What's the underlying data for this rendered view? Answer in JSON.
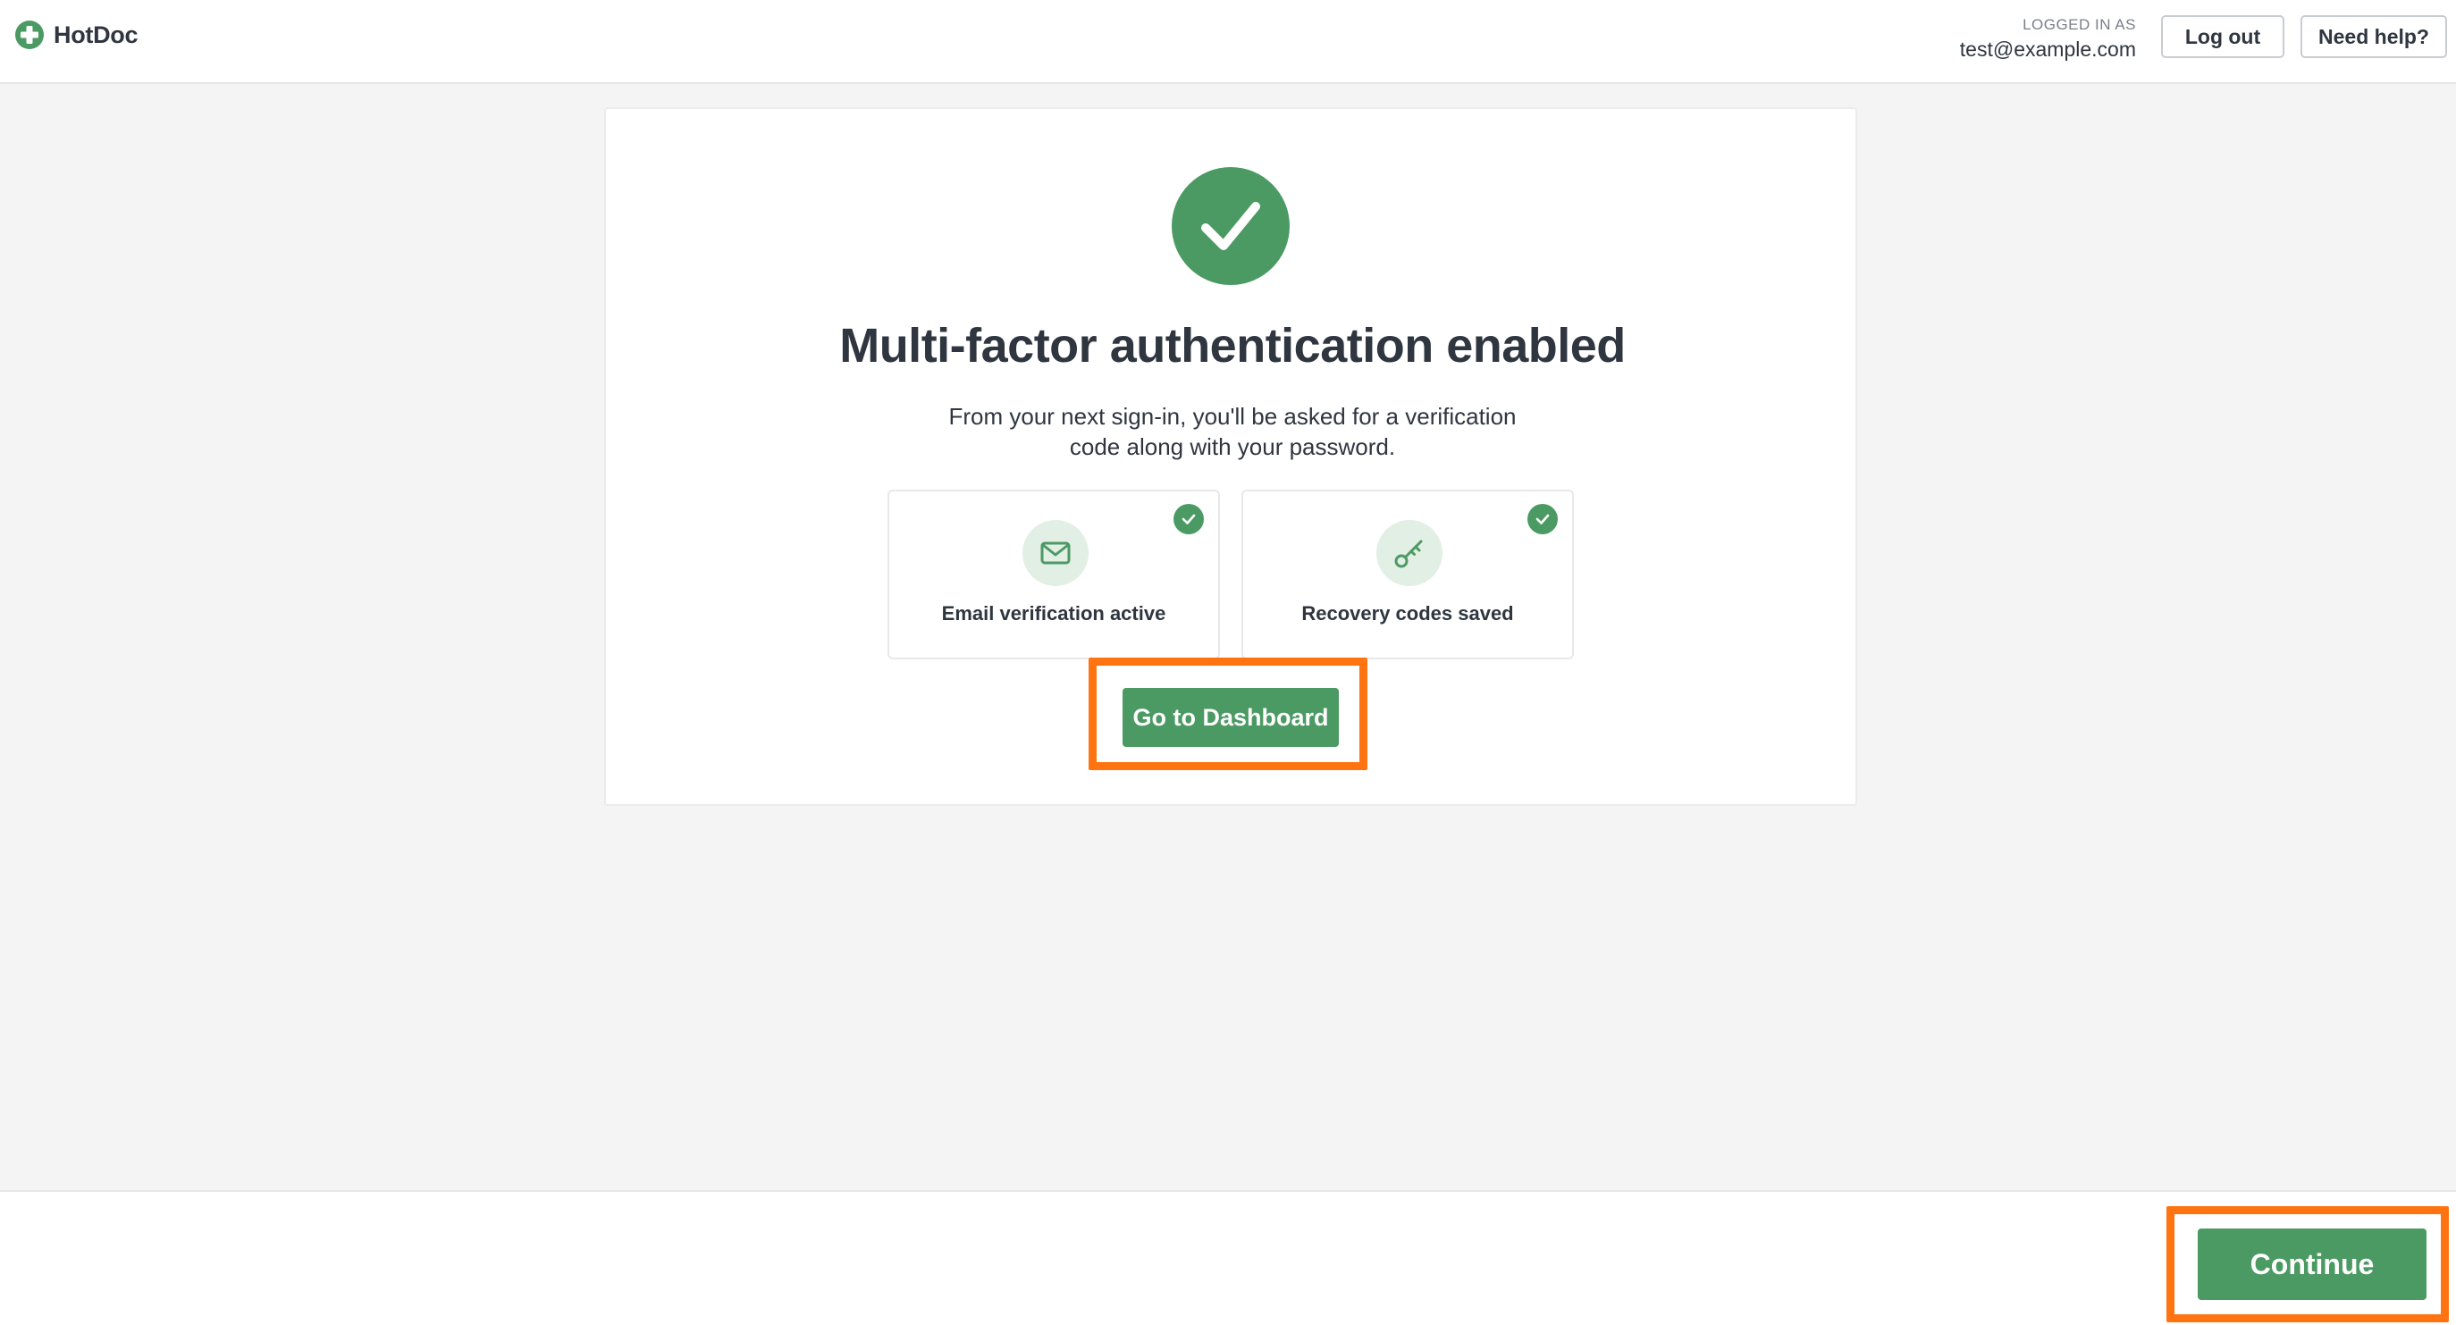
{
  "header": {
    "brand": "HotDoc",
    "logged_in_caption": "LOGGED IN AS",
    "user_email": "test@example.com",
    "logout_label": "Log out",
    "help_label": "Need help?"
  },
  "main": {
    "title": "Multi-factor authentication enabled",
    "description": "From your next sign-in, you'll be asked for a verification code along with your password.",
    "features": [
      {
        "label": "Email verification active",
        "icon": "mail-icon",
        "status": "complete"
      },
      {
        "label": "Recovery codes saved",
        "icon": "key-icon",
        "status": "complete"
      }
    ],
    "dashboard_button": "Go to Dashboard"
  },
  "footer": {
    "continue_label": "Continue"
  },
  "colors": {
    "accent_green": "#4c9a63",
    "highlight_orange": "#ff7410",
    "icon_bg": "#e2efe5"
  }
}
